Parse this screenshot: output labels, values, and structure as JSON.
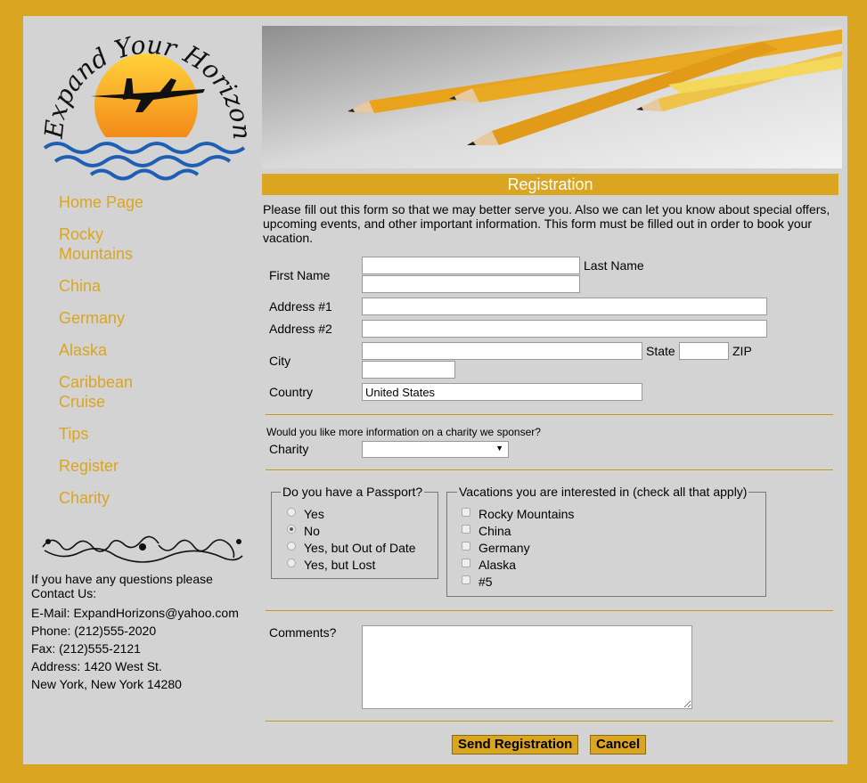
{
  "logo": {
    "text": "Expand Your Horizons"
  },
  "nav": [
    {
      "label": "Home Page"
    },
    {
      "label": "Rocky Mountains"
    },
    {
      "label": "China"
    },
    {
      "label": "Germany"
    },
    {
      "label": "Alaska"
    },
    {
      "label": "Caribbean Cruise"
    },
    {
      "label": "Tips"
    },
    {
      "label": "Register"
    },
    {
      "label": "Charity"
    }
  ],
  "contact": {
    "question": "If you have any questions please Contact Us:",
    "email": "E-Mail: ExpandHorizons@yahoo.com",
    "phone": "Phone: (212)555-2020",
    "fax": "Fax: (212)555-2121",
    "address": "Address: 1420 West St.",
    "city_line": "New York, New York 14280"
  },
  "registration": {
    "title": "Registration",
    "intro": "Please fill out this form so that we may better serve you. Also we can let you know about special offers, upcoming events, and other important information. This form must be filled out in order to book your vacation."
  },
  "form": {
    "first_name_label": "First Name",
    "first_name_value": "",
    "last_name_label": "Last Name",
    "last_name_value": "",
    "address1_label": "Address #1",
    "address1_value": "",
    "address2_label": "Address #2",
    "address2_value": "",
    "city_label": "City",
    "city_value": "",
    "state_label": "State",
    "state_value": "",
    "zip_label": "ZIP",
    "zip_value": "",
    "country_label": "Country",
    "country_value": "United States",
    "charity_question": "Would you like more information on a charity we sponser?",
    "charity_label": "Charity",
    "charity_selected": "",
    "passport_legend": "Do you have a Passport?",
    "passport_options": [
      {
        "label": "Yes",
        "selected": false
      },
      {
        "label": "No",
        "selected": true
      },
      {
        "label": "Yes, but Out of Date",
        "selected": false
      },
      {
        "label": "Yes, but Lost",
        "selected": false
      }
    ],
    "vacations_legend": "Vacations you are interested in (check all that apply)",
    "vacation_options": [
      {
        "label": "Rocky Mountains",
        "checked": false
      },
      {
        "label": "China",
        "checked": false
      },
      {
        "label": "Germany",
        "checked": false
      },
      {
        "label": "Alaska",
        "checked": false
      },
      {
        "label": "#5",
        "checked": false
      }
    ],
    "comments_label": "Comments?",
    "comments_value": "",
    "submit_label": "Send Registration",
    "cancel_label": "Cancel"
  },
  "colors": {
    "accent": "#DAA520",
    "panel": "#D3D3D3"
  }
}
